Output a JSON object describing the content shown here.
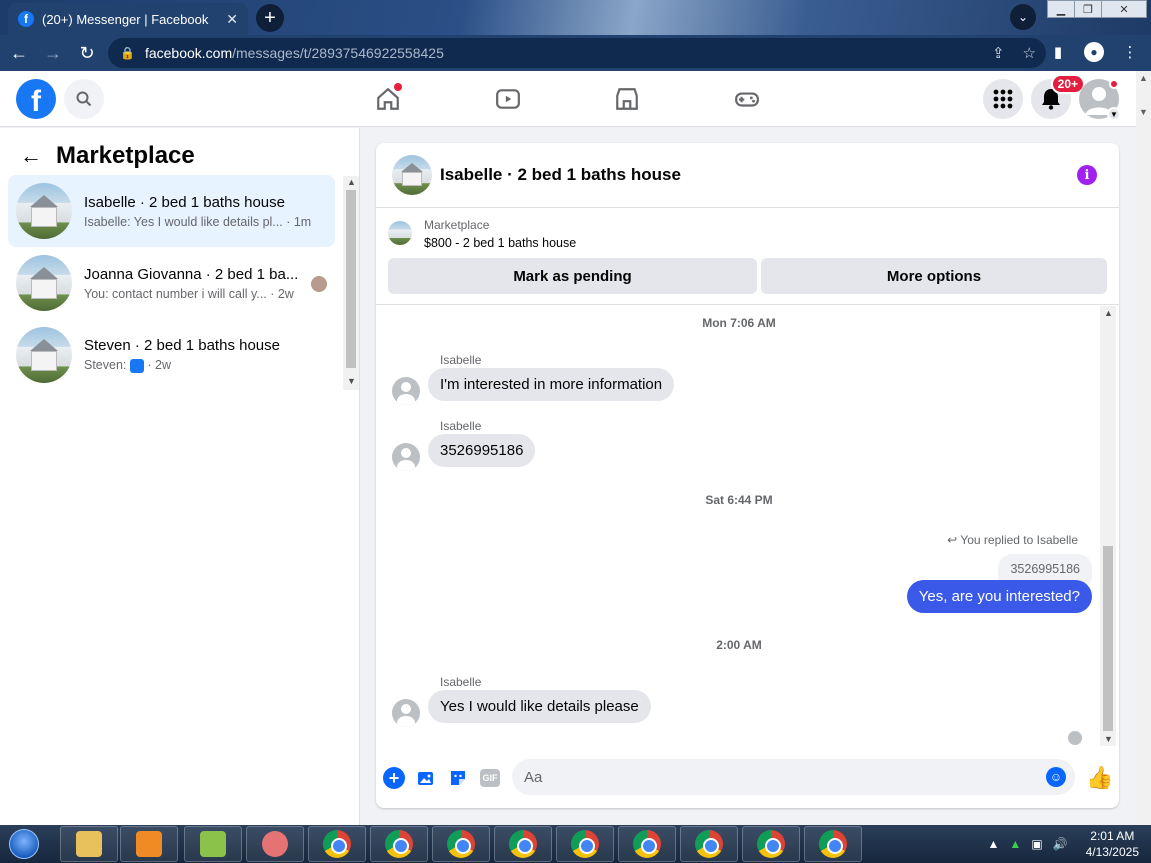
{
  "browser": {
    "tab_title": "(20+) Messenger | Facebook",
    "url_host": "facebook.com",
    "url_path": "/messages/t/28937546922558425"
  },
  "header": {
    "notifications_badge": "20+"
  },
  "sidebar": {
    "title": "Marketplace",
    "conversations": [
      {
        "name": "Isabelle · 2 bed 1 baths house",
        "preview": "Isabelle: Yes I would like details pl...",
        "time": "· 1m"
      },
      {
        "name": "Joanna Giovanna · 2 bed 1 ba...",
        "preview": "You: contact number i will call y...",
        "time": "· 2w"
      },
      {
        "name": "Steven · 2 bed 1 baths house",
        "preview": "Steven: ",
        "time": "· 2w"
      }
    ]
  },
  "chat": {
    "title": "Isabelle · 2 bed 1 baths house",
    "marketplace_label": "Marketplace",
    "listing": "$800 - 2 bed 1 baths house",
    "pending_button": "Mark as pending",
    "more_button": "More options",
    "timestamps": [
      "Mon 7:06 AM",
      "Sat 6:44 PM",
      "2:00 AM"
    ],
    "messages": [
      {
        "sender": "Isabelle",
        "text": "I'm interested in more information"
      },
      {
        "sender": "Isabelle",
        "text": "3526995186"
      },
      {
        "sender": "Isabelle",
        "text": "Yes I would like details please"
      }
    ],
    "replied_label": "You replied to Isabelle",
    "quoted_text": "3526995186",
    "outgoing_text": "Yes, are you interested?",
    "composer_placeholder": "Aa"
  },
  "taskbar": {
    "time": "2:01 AM",
    "date": "4/13/2025"
  },
  "colors": {
    "fb_blue": "#1877f2",
    "outgoing_bubble": "#3a59e8",
    "active_conversation": "#e7f3ff",
    "info_icon": "#a020f0"
  }
}
